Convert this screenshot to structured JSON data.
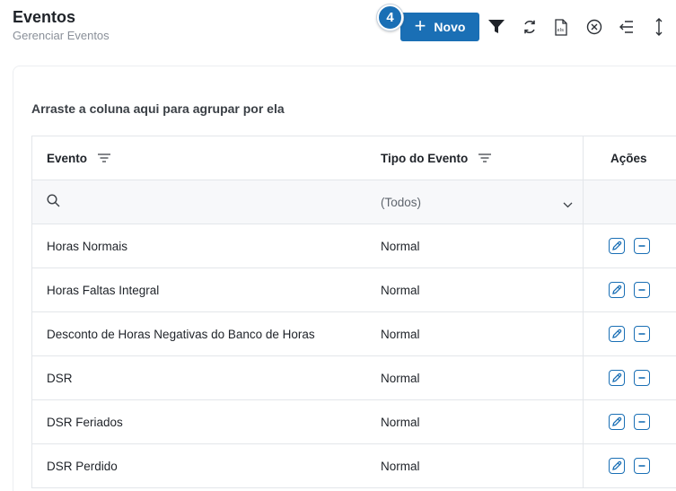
{
  "header": {
    "title": "Eventos",
    "subtitle": "Gerenciar Eventos"
  },
  "toolbar": {
    "new_label": "Novo",
    "step_number": "4",
    "icons": [
      "plus-icon",
      "filter-icon",
      "refresh-icon",
      "export-xls-icon",
      "clear-icon",
      "collapse-icon",
      "expand-vertical-icon"
    ]
  },
  "grid": {
    "group_hint": "Arraste a coluna aqui para agrupar por ela",
    "columns": {
      "evento": "Evento",
      "tipo": "Tipo do Evento",
      "acoes": "Ações"
    },
    "filter": {
      "tipo_selected": "(Todos)"
    },
    "rows": [
      {
        "evento": "Horas Normais",
        "tipo": "Normal"
      },
      {
        "evento": "Horas Faltas Integral",
        "tipo": "Normal"
      },
      {
        "evento": "Desconto de Horas Negativas do Banco de Horas",
        "tipo": "Normal"
      },
      {
        "evento": "DSR",
        "tipo": "Normal"
      },
      {
        "evento": "DSR Feriados",
        "tipo": "Normal"
      },
      {
        "evento": "DSR Perdido",
        "tipo": "Normal"
      }
    ]
  },
  "colors": {
    "accent": "#1a6fb5",
    "text": "#1f2329",
    "muted": "#8a9099",
    "border": "#e3e6ea"
  }
}
